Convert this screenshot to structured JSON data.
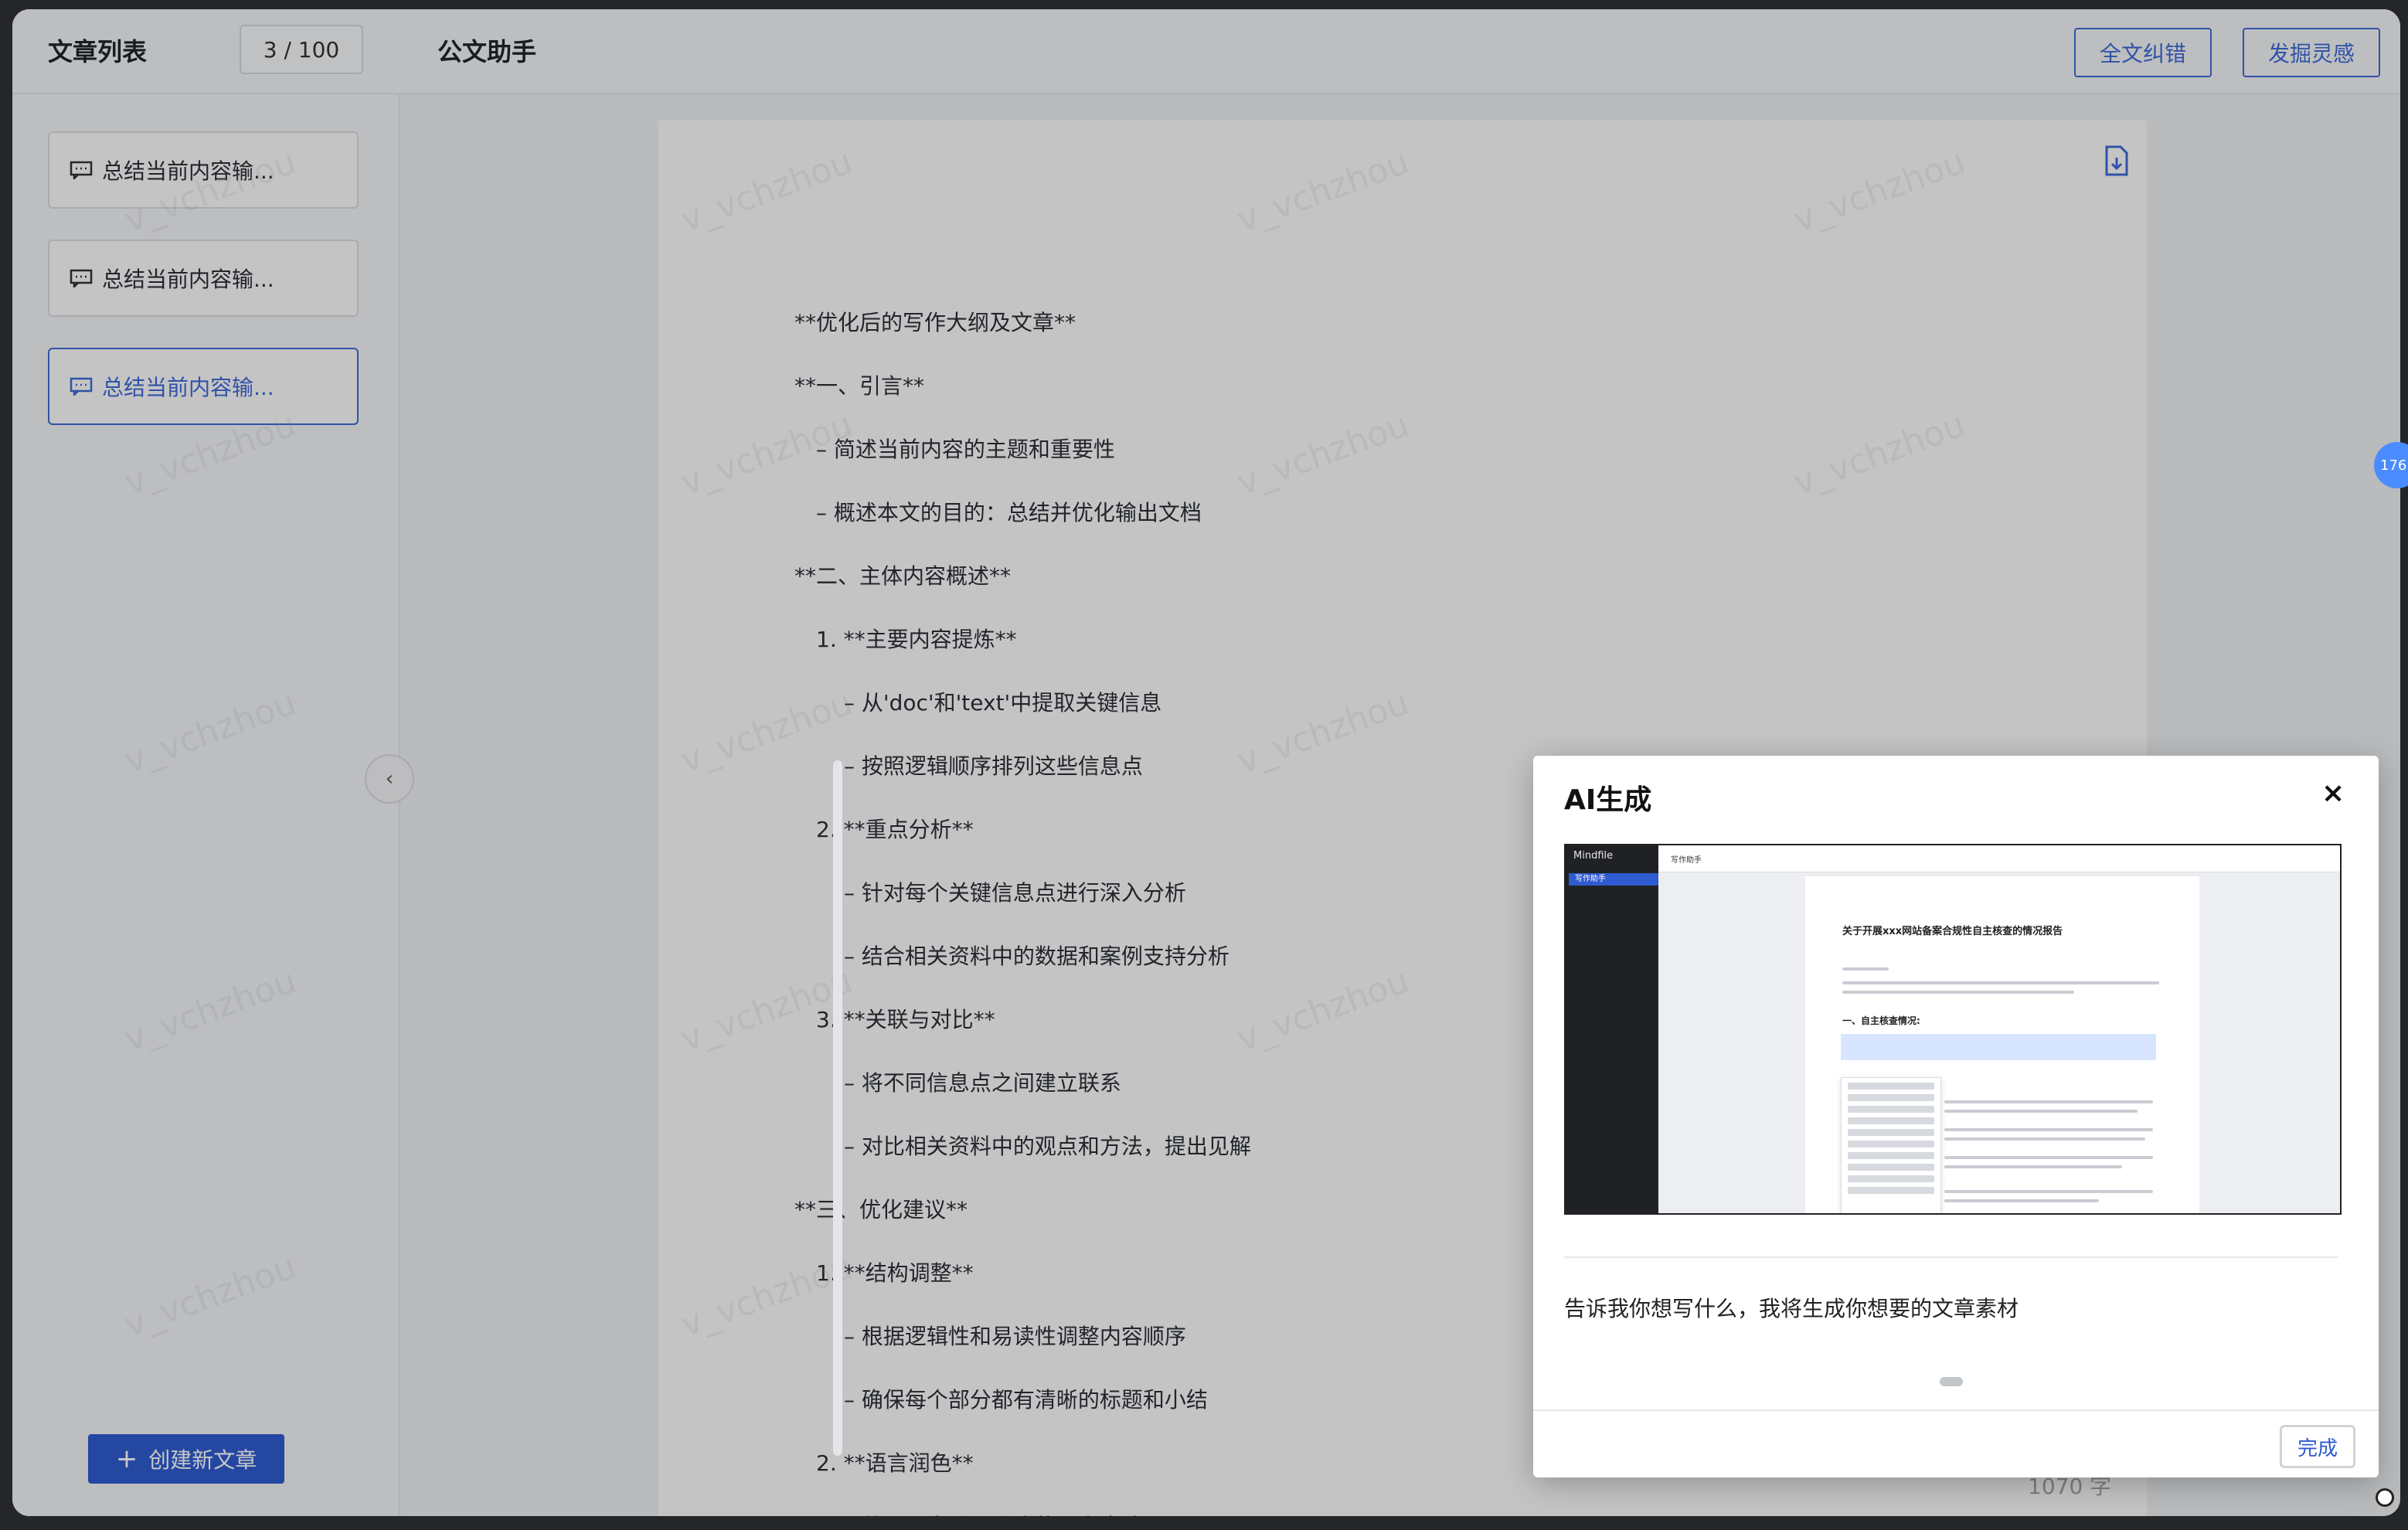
{
  "sidebar": {
    "title": "文章列表",
    "counter": "3 / 100",
    "items": [
      {
        "label": "总结当前内容输..."
      },
      {
        "label": "总结当前内容输..."
      },
      {
        "label": "总结当前内容输..."
      }
    ],
    "create_label": "创建新文章",
    "collapse_icon": "chevron-left-icon"
  },
  "header": {
    "title": "公文助手",
    "proofread_label": "全文纠错",
    "inspire_label": "发掘灵感"
  },
  "document": {
    "lines": [
      "**优化后的写作大纲及文章**",
      "**一、引言**",
      "– 简述当前内容的主题和重要性",
      "– 概述本文的目的：总结并优化输出文档",
      "**二、主体内容概述**",
      "1. **主要内容提炼**",
      "– 从'doc'和'text'中提取关键信息",
      "– 按照逻辑顺序排列这些信息点",
      "2. **重点分析**",
      "– 针对每个关键信息点进行深入分析",
      "– 结合相关资料中的数据和案例支持分析",
      "3. **关联与对比**",
      "– 将不同信息点之间建立联系",
      "– 对比相关资料中的观点和方法，提出见解",
      "**三、优化建议**",
      "1. **结构调整**",
      "– 根据逻辑性和易读性调整内容顺序",
      "– 确保每个部分都有清晰的标题和小结",
      "2. **语言润色**",
      "– 使用更生动、准确的语言表达"
    ],
    "word_count": "1070 字",
    "watermark": "v_vchzhou"
  },
  "side_badge": "176",
  "modal": {
    "title": "AI生成",
    "close_symbol": "×",
    "preview": {
      "app_name": "Mindfile",
      "nav_item": "写作助手",
      "top_title": "写作助手",
      "doc_title": "关于开展xxx网站备案合规性自主核查的情况报告",
      "section_title": "一、自主核查情况:"
    },
    "description": "告诉我你想写什么，我将生成你想要的文章素材",
    "done_label": "完成"
  },
  "colors": {
    "accent": "#3f6ad8",
    "primary_button": "#2f5bd0",
    "badge": "#4a8cff"
  }
}
